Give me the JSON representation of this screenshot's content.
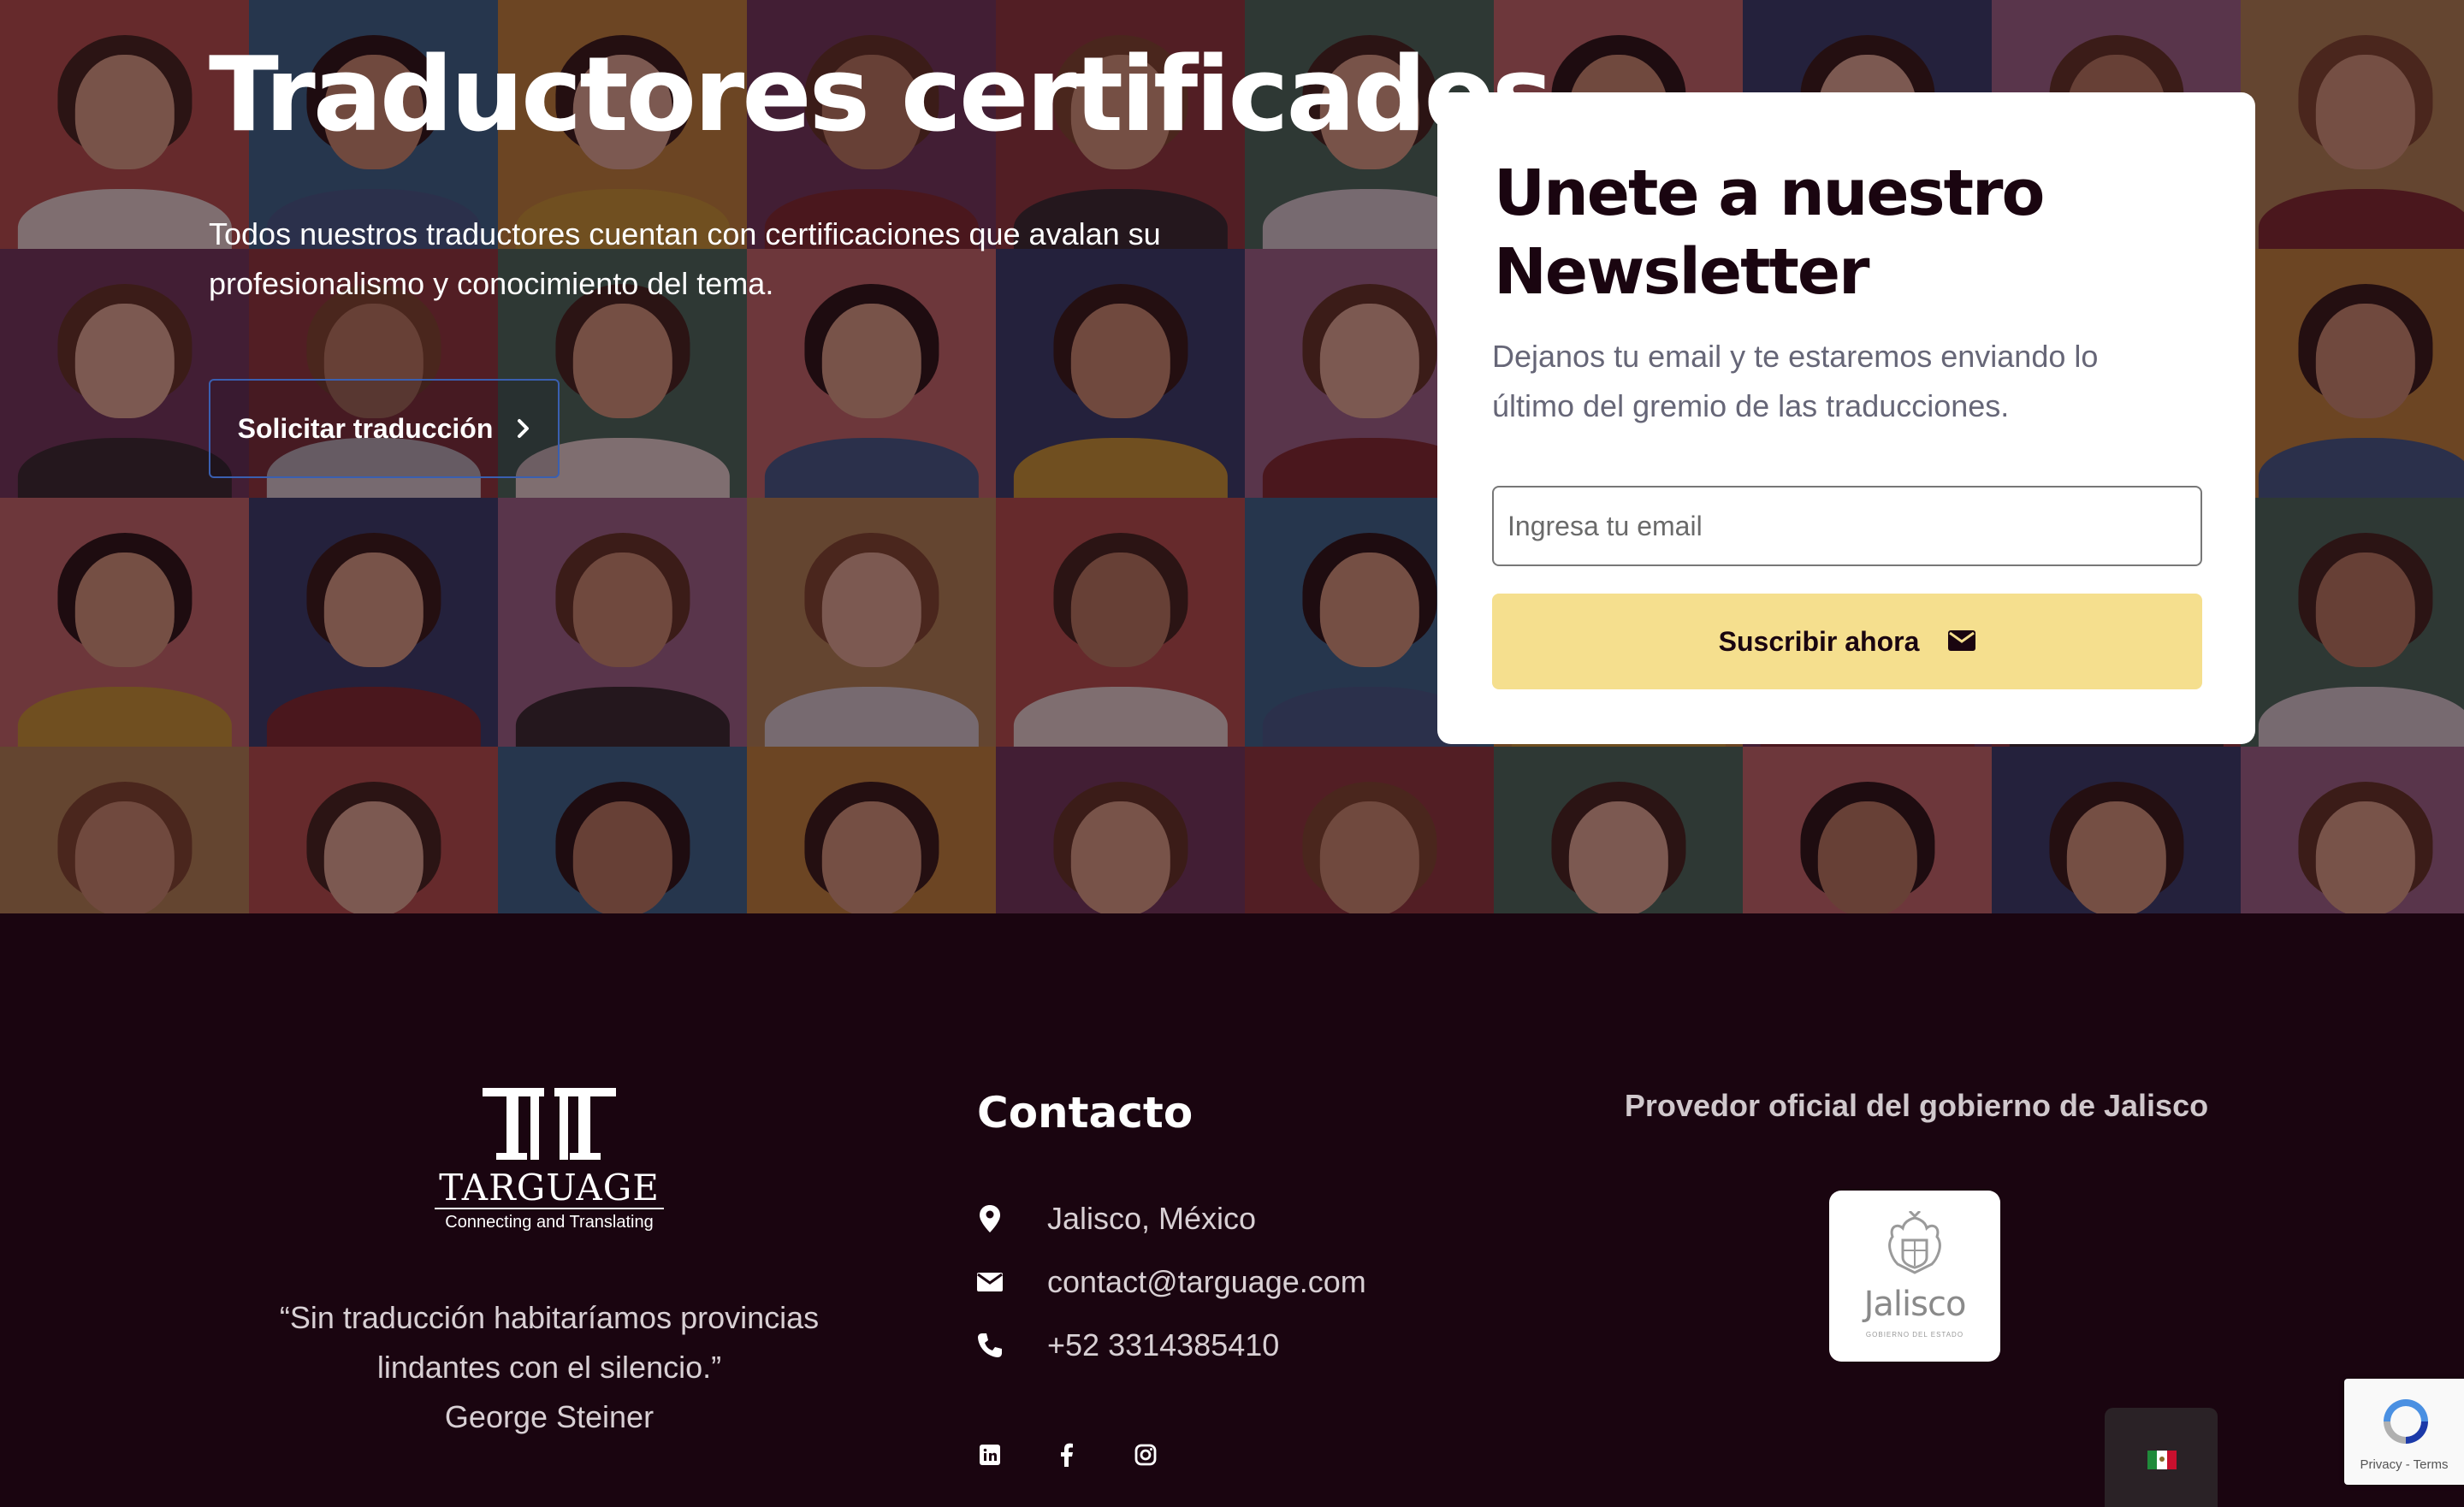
{
  "hero": {
    "title": "Traductores certificados",
    "description": "Todos nuestros traductores cuentan con certificaciones que avalan su profesionalismo y conocimiento del tema.",
    "cta_label": "Solicitar traducción",
    "overlay_color": "#1e0612"
  },
  "newsletter": {
    "title": "Unete a nuestro Newsletter",
    "description": "Dejanos tu email y te estaremos enviando lo último del gremio de las traducciones.",
    "email_placeholder": "Ingresa tu email",
    "email_value": "",
    "subscribe_label": "Suscribir ahora",
    "button_color": "#f5df8e"
  },
  "footer": {
    "logo_name": "TARGUAGE",
    "logo_tagline": "Connecting and Translating",
    "quote_lines": [
      "“Sin traducción habitaríamos provincias",
      "lindantes con el silencio.”"
    ],
    "quote_author": "George Steiner",
    "contact": {
      "title": "Contacto",
      "location": "Jalisco, México",
      "email": "contact@targuage.com",
      "phone": "+52 3314385410"
    },
    "social_icons": [
      "linkedin-icon",
      "facebook-icon",
      "instagram-icon"
    ],
    "gov": {
      "title": "Provedor oficial del gobierno de Jalisco",
      "badge_text": "Jalisco",
      "badge_subtext": "GOBIERNO DEL ESTADO"
    },
    "background_color": "#1a0510"
  },
  "language_switcher": {
    "flag": "mexico-flag-icon"
  },
  "recaptcha": {
    "terms": "Privacy - Terms"
  }
}
